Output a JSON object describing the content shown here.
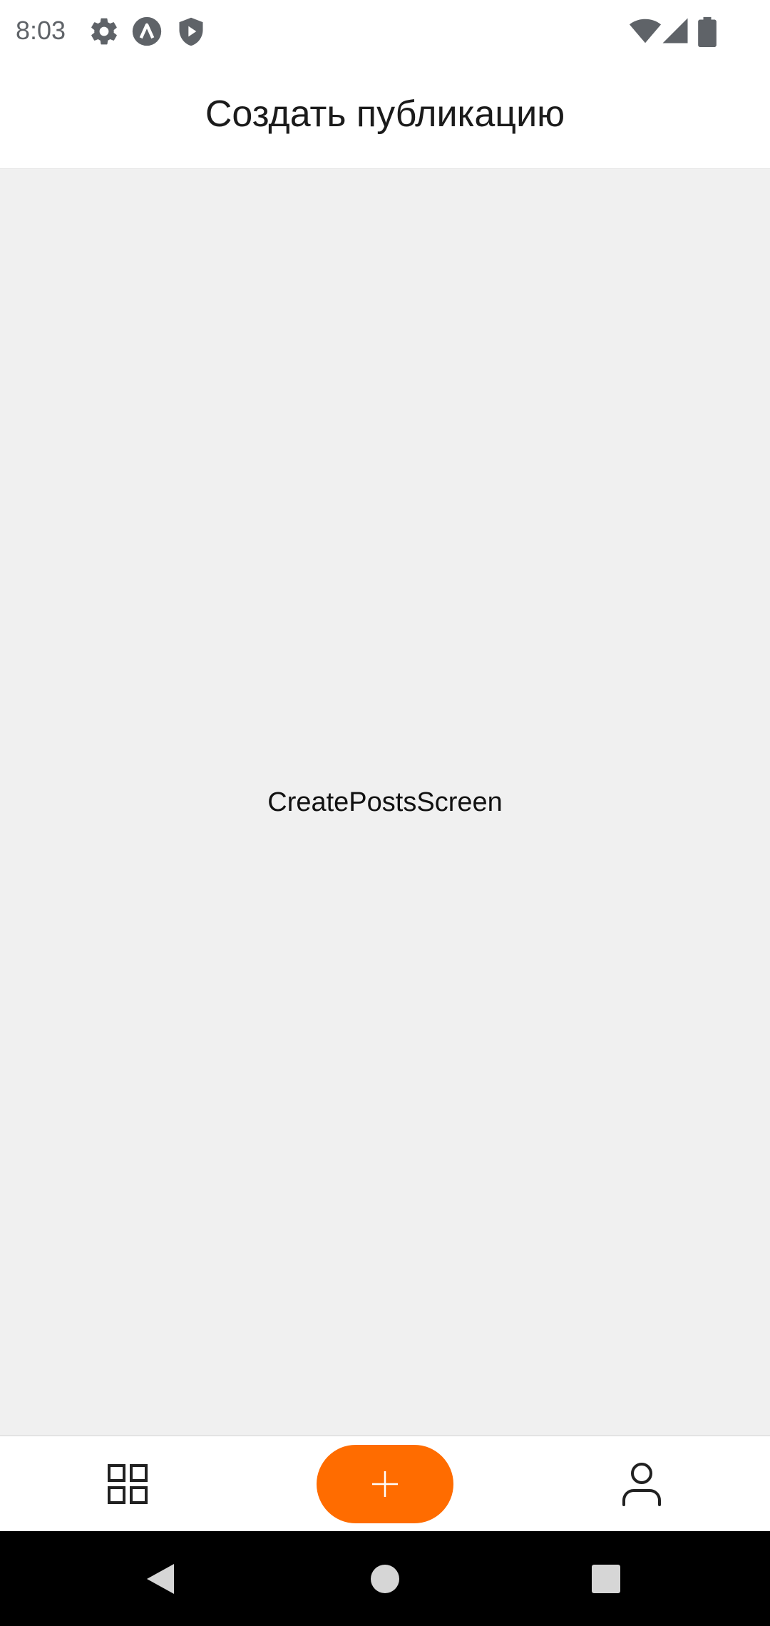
{
  "status_bar": {
    "time": "8:03",
    "icons_left": [
      "gear-icon",
      "a-icon",
      "shield-play-icon"
    ],
    "icons_right": [
      "wifi-icon",
      "signal-icon",
      "battery-icon"
    ]
  },
  "header": {
    "title": "Создать публикацию"
  },
  "content": {
    "label": "CreatePostsScreen"
  },
  "tab_bar": {
    "items": [
      {
        "icon": "grid-icon"
      },
      {
        "icon": "plus-icon",
        "accent": "#FF6C00"
      },
      {
        "icon": "user-icon"
      }
    ]
  },
  "nav_bar": {
    "buttons": [
      "back-icon",
      "home-icon",
      "recents-icon"
    ]
  },
  "colors": {
    "accent": "#FF6C00",
    "content_background": "#F0F0F0",
    "nav_background": "#000000"
  }
}
